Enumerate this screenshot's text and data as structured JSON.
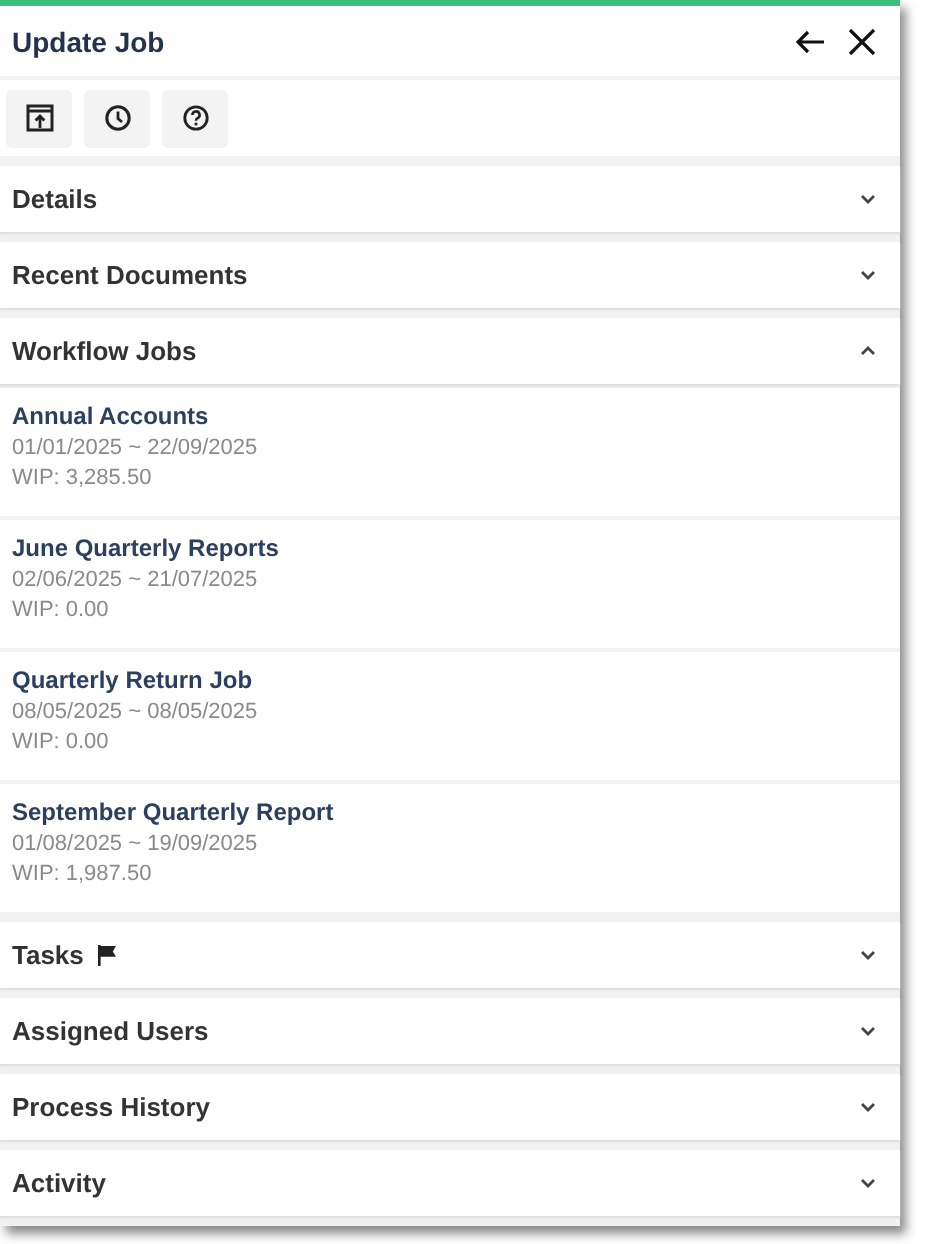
{
  "header": {
    "title": "Update Job"
  },
  "sections": [
    {
      "title": "Details",
      "kind": "plain",
      "expanded": false
    },
    {
      "title": "Recent Documents",
      "kind": "plain",
      "expanded": false
    },
    {
      "title": "Workflow Jobs",
      "kind": "plain",
      "expanded": true,
      "jobs": [
        {
          "name": "Annual Accounts",
          "dates": "01/01/2025 ~ 22/09/2025",
          "wip": "WIP: 3,285.50"
        },
        {
          "name": "June Quarterly Reports",
          "dates": "02/06/2025 ~ 21/07/2025",
          "wip": "WIP: 0.00"
        },
        {
          "name": "Quarterly Return Job",
          "dates": "08/05/2025 ~ 08/05/2025",
          "wip": "WIP: 0.00"
        },
        {
          "name": "September Quarterly Report",
          "dates": "01/08/2025 ~ 19/09/2025",
          "wip": "WIP: 1,987.50"
        }
      ]
    },
    {
      "title": "Tasks",
      "kind": "flagged",
      "expanded": false
    },
    {
      "title": "Assigned Users",
      "kind": "plain",
      "expanded": false
    },
    {
      "title": "Process History",
      "kind": "plain",
      "expanded": false
    },
    {
      "title": "Activity",
      "kind": "plain",
      "expanded": false
    }
  ]
}
